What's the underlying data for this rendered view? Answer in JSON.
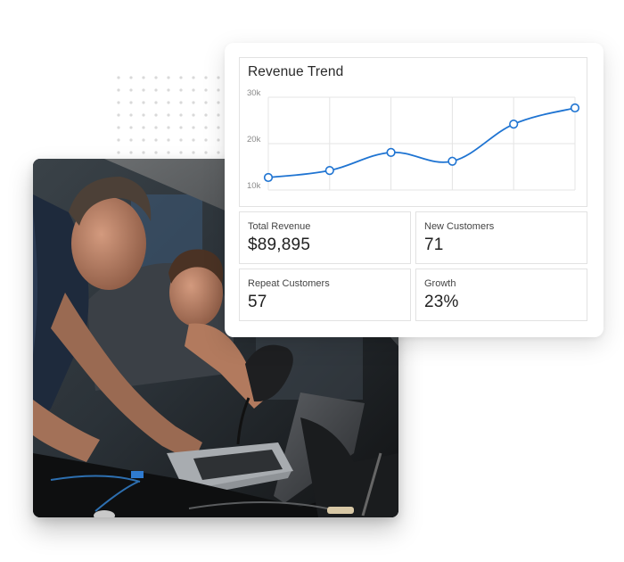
{
  "dashboard": {
    "chart": {
      "title": "Revenue Trend"
    },
    "stats": [
      {
        "label": "Total Revenue",
        "value": "$89,895"
      },
      {
        "label": "New Customers",
        "value": "71"
      },
      {
        "label": "Repeat Customers",
        "value": "57"
      },
      {
        "label": "Growth",
        "value": "23%"
      }
    ]
  },
  "photo": {
    "description": "Two mechanics working on a car engine with a laptop"
  },
  "colors": {
    "accent": "#1f74d2",
    "grid": "#e4e4e4",
    "border": "#e2e2e2"
  },
  "chart_data": {
    "type": "line",
    "title": "Revenue Trend",
    "xlabel": "",
    "ylabel": "",
    "x": [
      1,
      2,
      3,
      4,
      5,
      6
    ],
    "series": [
      {
        "name": "Revenue",
        "values": [
          12700,
          14200,
          18100,
          16200,
          24200,
          27700
        ]
      }
    ],
    "ylim": [
      10000,
      30000
    ],
    "yticks": [
      10000,
      20000,
      30000
    ],
    "ytick_labels": [
      "10k",
      "20k",
      "30k"
    ],
    "grid": true,
    "legend": "none",
    "smooth": true,
    "markers": "hollow-circle"
  }
}
